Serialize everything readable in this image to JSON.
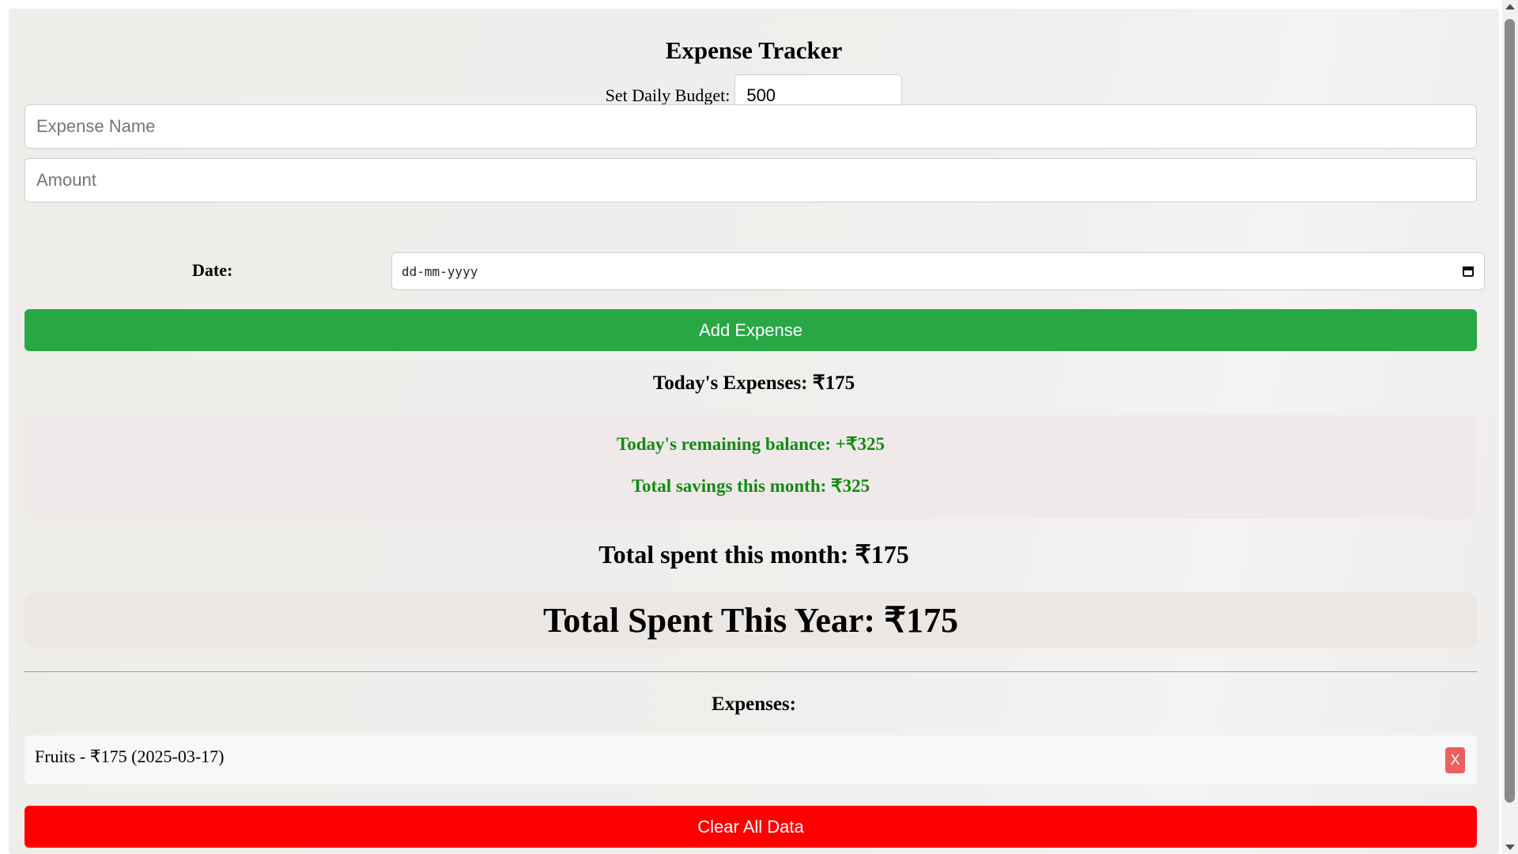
{
  "app": {
    "title": "Expense Tracker"
  },
  "budget": {
    "label": "Set Daily Budget:",
    "value": "500"
  },
  "form": {
    "expense_name_placeholder": "Expense Name",
    "expense_name_value": "",
    "amount_placeholder": "Amount",
    "amount_value": "",
    "date_label": "Date:",
    "date_placeholder": "dd-mm-yyyy",
    "date_icon": "calendar-icon",
    "add_button_label": "Add Expense"
  },
  "summary": {
    "today_expenses": "Today's Expenses: ₹175",
    "remaining_balance": "Today's remaining balance: +₹325",
    "month_savings": "Total savings this month: ₹325",
    "month_spent": "Total spent this month: ₹175",
    "year_spent": "Total Spent This Year: ₹175"
  },
  "expenses": {
    "heading": "Expenses:",
    "items": [
      {
        "text": "Fruits - ₹175 (2025-03-17)",
        "delete_label": "X"
      }
    ]
  },
  "actions": {
    "clear_label": "Clear All Data"
  },
  "colors": {
    "add_button": "#28a745",
    "clear_button": "#ff0000",
    "delete_button": "#ee5e5e",
    "balance_text": "#138a13"
  }
}
